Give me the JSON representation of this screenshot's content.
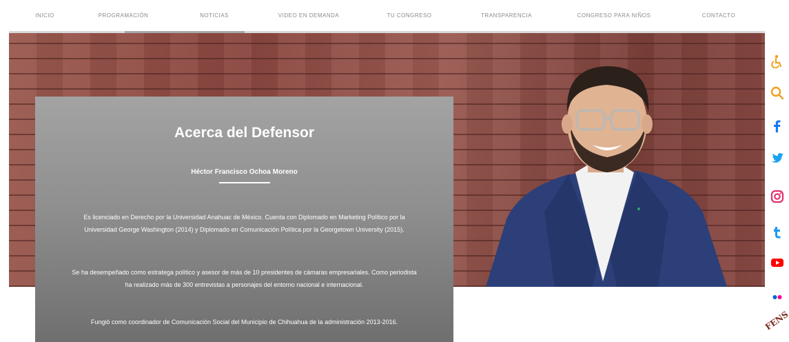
{
  "nav": {
    "items": [
      {
        "label": "INICIO"
      },
      {
        "label": "PROGRAMACIÓN"
      },
      {
        "label": "NOTICIAS"
      },
      {
        "label": "VIDEO EN DEMANDA"
      },
      {
        "label": "TU CONGRESO"
      },
      {
        "label": "TRANSPARENCIA"
      },
      {
        "label": "CONGRESO PARA NIÑOS"
      },
      {
        "label": "CONTACTO"
      }
    ]
  },
  "card": {
    "title": "Acerca del Defensor",
    "name": "Héctor Francisco Ochoa Moreno",
    "paragraphs": [
      "Es licenciado en Derecho por la Universidad Anahuac de México. Cuenta con Diplomado en Marketing Político por la Universidad George Washington (2014) y Diplomado en Comunicación Política por la Georgetown University (2015).",
      "Se ha desempeñado como estratega político y asesor de más de 10 presidentes de cámaras empresariales. Como periodista ha realizado más de 300 entrevistas a personajes del entorno nacional e internacional.",
      "Fungió como coordinador de Comunicación Social del Municipio de Chihuahua de la administración 2013-2016."
    ]
  },
  "social": {
    "icons": [
      "accessibility-icon",
      "search-icon",
      "facebook-icon",
      "twitter-icon",
      "instagram-icon",
      "tumblr-icon",
      "youtube-icon",
      "flickr-icon"
    ],
    "colors": {
      "accessibility": "#f0a020",
      "search": "#f0a020",
      "facebook": "#1877f2",
      "twitter": "#1da1f2",
      "instagram": "#e1306c",
      "tumblr": "#1d9bf0",
      "youtube": "#ff0000",
      "flickr": "#0063dc"
    }
  },
  "seal": {
    "text": "FENS"
  }
}
